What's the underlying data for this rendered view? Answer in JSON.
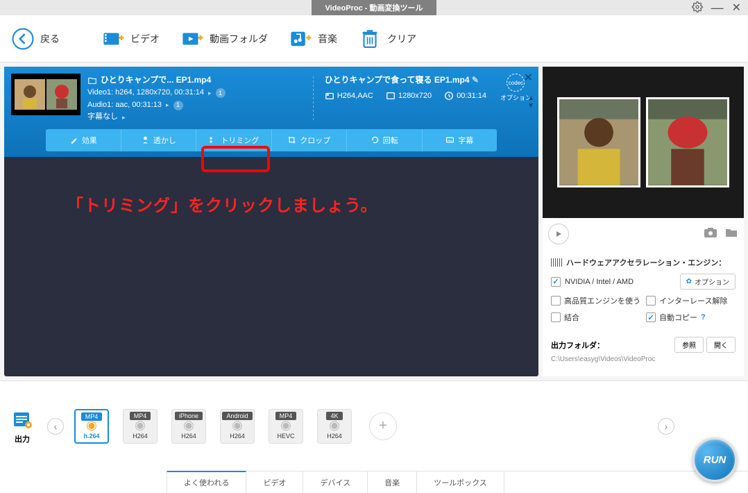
{
  "titlebar": {
    "title": "VideoProc - 動画変換ツール"
  },
  "toolbar": {
    "back": "戻る",
    "video": "ビデオ",
    "folder": "動画フォルダ",
    "music": "音楽",
    "clear": "クリア"
  },
  "video_item": {
    "input_title": "ひとりキャンプで... EP1.mp4",
    "video_meta": "Video1: h264, 1280x720, 00:31:14",
    "audio_meta": "Audio1: aac, 00:31:13",
    "subtitle_meta": "字幕なし",
    "badge1": "1",
    "badge2": "1",
    "output_title": "ひとりキャンプで食って寝る EP1.mp4",
    "spec_codec": "H264,AAC",
    "spec_res": "1280x720",
    "spec_dur": "00:31:14",
    "codec_label": "codec",
    "option_label": "オプション"
  },
  "edit_tabs": {
    "effect": "効果",
    "watermark": "透かし",
    "trim": "トリミング",
    "crop": "クロップ",
    "rotate": "回転",
    "subtitle": "字幕"
  },
  "annotation": "「トリミング」をクリックしましょう。",
  "hw": {
    "header": "ハードウェアアクセラレーション・エンジン：",
    "gpu": "NVIDIA / Intel / AMD",
    "option_btn": "オプション",
    "hq": "高品質エンジンを使う",
    "deint": "インターレース解除",
    "merge": "結合",
    "autocopy": "自動コピー"
  },
  "output_folder": {
    "label": "出力フォルダ：",
    "browse": "参照",
    "open": "開く",
    "path": "C:\\Users\\easyg\\Videos\\VideoProc"
  },
  "output_section": {
    "label": "出力"
  },
  "presets": [
    {
      "top": "MP4",
      "bot": "h.264",
      "active": true,
      "topClass": ""
    },
    {
      "top": "MP4",
      "bot": "H264",
      "active": false,
      "topClass": "dark"
    },
    {
      "top": "iPhone",
      "bot": "H264",
      "active": false,
      "topClass": "dark"
    },
    {
      "top": "Android",
      "bot": "H264",
      "active": false,
      "topClass": "dark"
    },
    {
      "top": "MP4",
      "bot": "HEVC",
      "active": false,
      "topClass": "dark"
    },
    {
      "top": "4K",
      "bot": "H264",
      "active": false,
      "topClass": "dark"
    }
  ],
  "bottom_tabs": {
    "popular": "よく使われる",
    "video": "ビデオ",
    "device": "デバイス",
    "music": "音楽",
    "toolbox": "ツールボックス"
  },
  "run": "RUN"
}
